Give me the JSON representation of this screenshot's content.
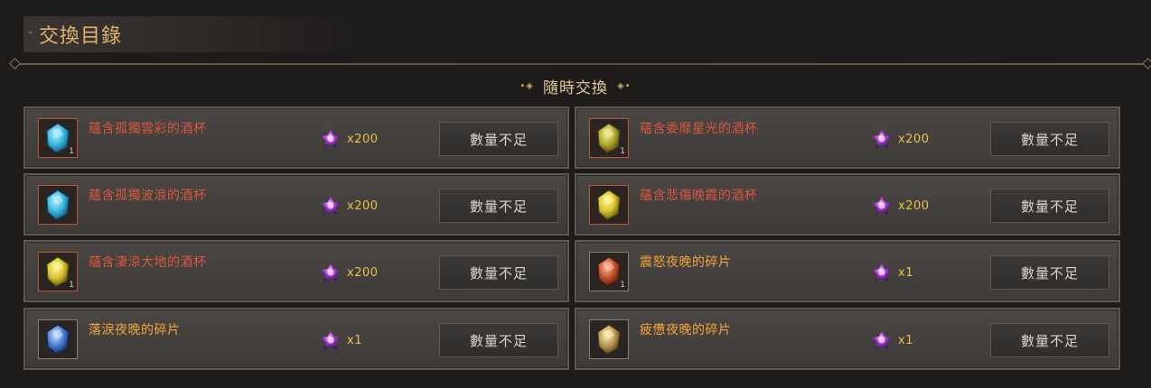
{
  "header": {
    "title": "交換目錄",
    "title_prefix": "-"
  },
  "section": {
    "label": "隨時交換",
    "ornament_left": "•◈",
    "ornament_right": "◈•"
  },
  "colors": {
    "title": "#e3b26e",
    "name_red": "#d8573f",
    "name_orange": "#f0a43a",
    "cost": "#e8c04a"
  },
  "items": [
    {
      "name": "蘊含孤獨雲彩的酒杯",
      "cost": "x200",
      "button": "數量不足",
      "name_color": "red",
      "gem_color": "cyan",
      "qty": "1"
    },
    {
      "name": "蘊含委靡星光的酒杯",
      "cost": "x200",
      "button": "數量不足",
      "name_color": "red",
      "gem_color": "olive",
      "qty": "1"
    },
    {
      "name": "蘊含孤獨波浪的酒杯",
      "cost": "x200",
      "button": "數量不足",
      "name_color": "red",
      "gem_color": "cyan",
      "qty": ""
    },
    {
      "name": "蘊含悲傷晚霞的酒杯",
      "cost": "x200",
      "button": "數量不足",
      "name_color": "red",
      "gem_color": "yellow",
      "qty": ""
    },
    {
      "name": "蘊含淒涼大地的酒杯",
      "cost": "x200",
      "button": "數量不足",
      "name_color": "red",
      "gem_color": "yellow",
      "qty": "1"
    },
    {
      "name": "震怒夜晚的碎片",
      "cost": "x1",
      "button": "數量不足",
      "name_color": "orange",
      "gem_color": "red",
      "qty": "1"
    },
    {
      "name": "落淚夜晚的碎片",
      "cost": "x1",
      "button": "數量不足",
      "name_color": "orange",
      "gem_color": "blue",
      "qty": ""
    },
    {
      "name": "疲憊夜晚的碎片",
      "cost": "x1",
      "button": "數量不足",
      "name_color": "orange",
      "gem_color": "tan",
      "qty": ""
    }
  ]
}
